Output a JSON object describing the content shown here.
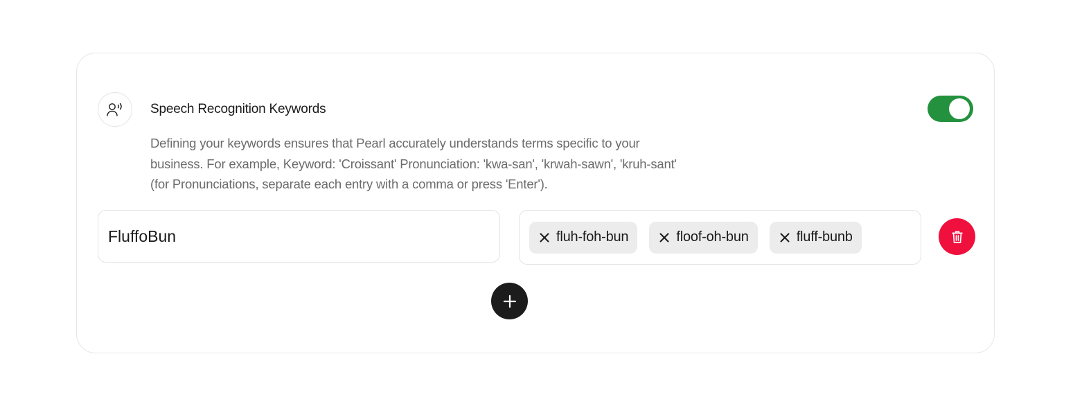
{
  "settings": {
    "title": "Speech Recognition Keywords",
    "description": "Defining your keywords ensures that Pearl accurately understands terms specific to your business. For example, Keyword: 'Croissant' Pronunciation: 'kwa-san', 'krwah-sawn', 'kruh-sant' (for Pronunciations, separate each entry with a comma or press 'Enter').",
    "enabled": true,
    "toggle_color": "#23913e"
  },
  "keyword_row": {
    "keyword": "FluffoBun",
    "pronunciations": [
      "fluh-foh-bun",
      "floof-oh-bun",
      "fluff-bunb"
    ],
    "delete_color": "#f0103d"
  },
  "icons": {
    "header": "speaking-person-icon",
    "chip_remove": "close-icon",
    "delete": "trash-icon",
    "add": "plus-icon"
  }
}
